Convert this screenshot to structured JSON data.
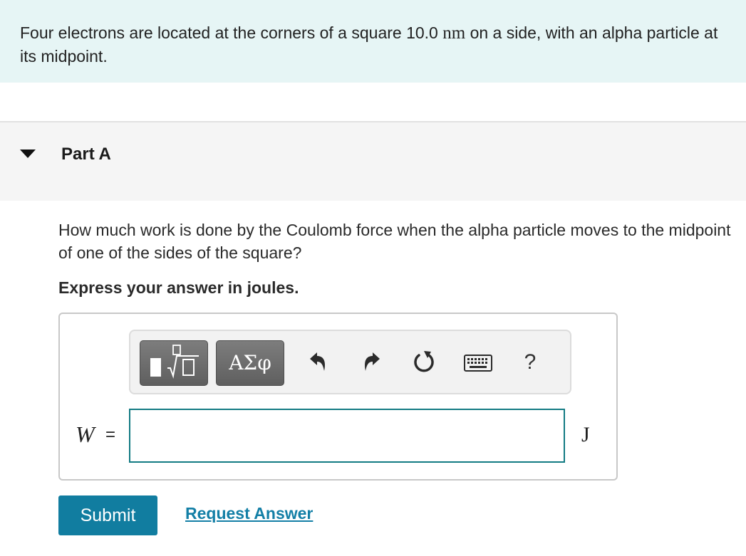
{
  "intro": {
    "text_before": "Four electrons are located at the corners of a square 10.0 ",
    "unit": "nm",
    "text_after": " on a side, with an alpha particle at its midpoint."
  },
  "part": {
    "title": "Part A"
  },
  "question": {
    "text": "How much work is done by the Coulomb force when the alpha particle moves to the midpoint of one of the sides of the square?",
    "instruction": "Express your answer in joules."
  },
  "toolbar": {
    "greek_label": "ΑΣφ",
    "help_label": "?",
    "icons": [
      "templates-icon",
      "greek-letters-icon",
      "undo-icon",
      "redo-icon",
      "reset-icon",
      "keyboard-icon",
      "help-icon"
    ]
  },
  "answer": {
    "variable": "W",
    "equals": "=",
    "value": "",
    "unit": "J"
  },
  "actions": {
    "submit_label": "Submit",
    "request_label": "Request Answer"
  },
  "colors": {
    "intro_bg": "#e6f5f5",
    "accent": "#117da0",
    "input_border": "#137b83"
  }
}
